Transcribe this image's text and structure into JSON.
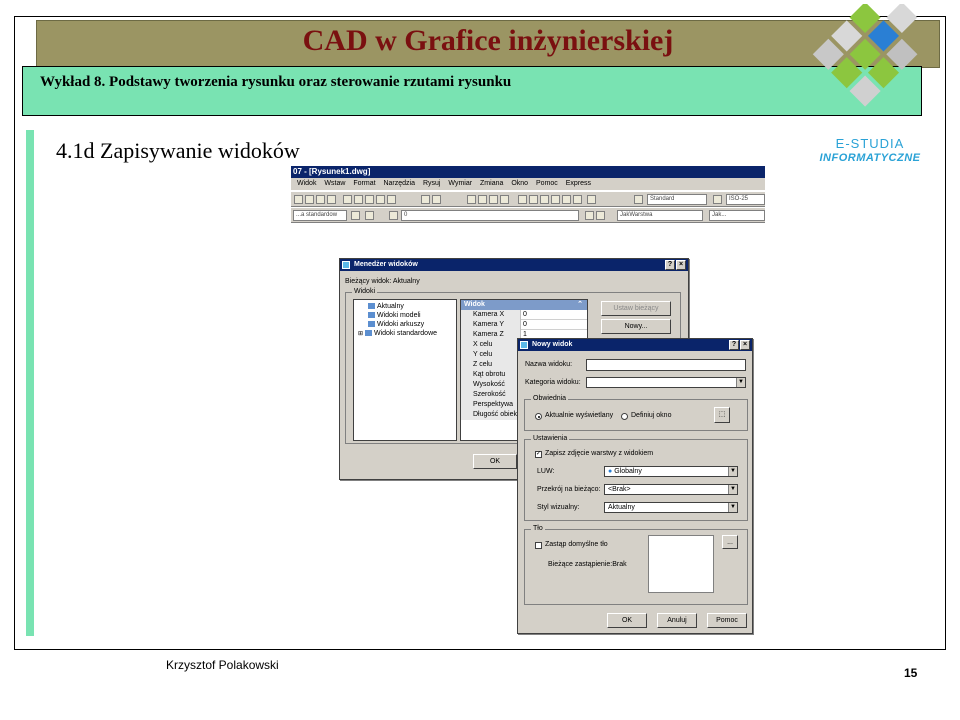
{
  "slide": {
    "title": "CAD w Grafice inżynierskiej",
    "subtitle": "Wykład 8.  Podstawy tworzenia rysunku oraz sterowanie rzutami rysunku",
    "section": "4.1d Zapisywanie widoków",
    "author": "Krzysztof Polakowski",
    "page": "15",
    "logo_line1": "E-STUDIA",
    "logo_line2": "INFORMATYCZNE",
    "colors": {
      "title_band": "#9b9563",
      "title_text": "#7a1010",
      "accent_green": "#79e3b2",
      "logo_blue": "#2aa2d6"
    }
  },
  "acad": {
    "window_title": "07 - [Rysunek1.dwg]",
    "menu": [
      "Widok",
      "Wstaw",
      "Format",
      "Narzędzia",
      "Rysuj",
      "Wymiar",
      "Zmiana",
      "Okno",
      "Pomoc",
      "Express"
    ],
    "combo_style": "Standard",
    "combo_iso": "ISO-25",
    "combo_standard": "...a standardow",
    "combo_layer": "0",
    "combo_layer_color": "JakWarstwa",
    "combo_linetype": "JakWarstwa",
    "combo_lineweight": "Jak..."
  },
  "manager": {
    "title": "Menedżer widoków",
    "current_view": "Bieżący widok: Aktualny",
    "group_views": "Widoki",
    "tree": [
      "Aktualny",
      "Widoki modeli",
      "Widoki arkuszy",
      "Widoki standardowe"
    ],
    "prop_header": "Widok",
    "props": [
      {
        "k": "Kamera X",
        "v": "0"
      },
      {
        "k": "Kamera Y",
        "v": "0"
      },
      {
        "k": "Kamera Z",
        "v": "1"
      },
      {
        "k": "X celu",
        "v": ""
      },
      {
        "k": "Y celu",
        "v": ""
      },
      {
        "k": "Z celu",
        "v": ""
      },
      {
        "k": "Kąt obrotu",
        "v": ""
      },
      {
        "k": "Wysokość",
        "v": ""
      },
      {
        "k": "Szerokość",
        "v": ""
      },
      {
        "k": "Perspektywa",
        "v": ""
      },
      {
        "k": "Długość obiek",
        "v": ""
      }
    ],
    "btn_set_current": "Ustaw bieżący",
    "btn_new": "Nowy...",
    "btn_ok": "OK"
  },
  "new_view": {
    "title": "Nowy widok",
    "name_label": "Nazwa widoku:",
    "name_value": "",
    "category_label": "Kategoria widoku:",
    "category_value": "",
    "group_boundary": "Obwiednia",
    "radio_current": "Aktualnie wyświetlany",
    "radio_define": "Definiuj okno",
    "group_settings": "Ustawienia",
    "chk_save_layers": "Zapisz zdjęcie warstwy z widokiem",
    "ucs_label": "LUW:",
    "ucs_value": "Globalny",
    "section_label": "Przekrój na bieżąco:",
    "section_value": "<Brak>",
    "visual_label": "Styl wizualny:",
    "visual_value": "Aktualny",
    "group_background": "Tło",
    "chk_override": "Zastąp domyślne tło",
    "current_override": "Bieżące zastąpienie:Brak",
    "btn_browse": "...",
    "btn_ok": "OK",
    "btn_cancel": "Anuluj",
    "btn_help": "Pomoc"
  }
}
